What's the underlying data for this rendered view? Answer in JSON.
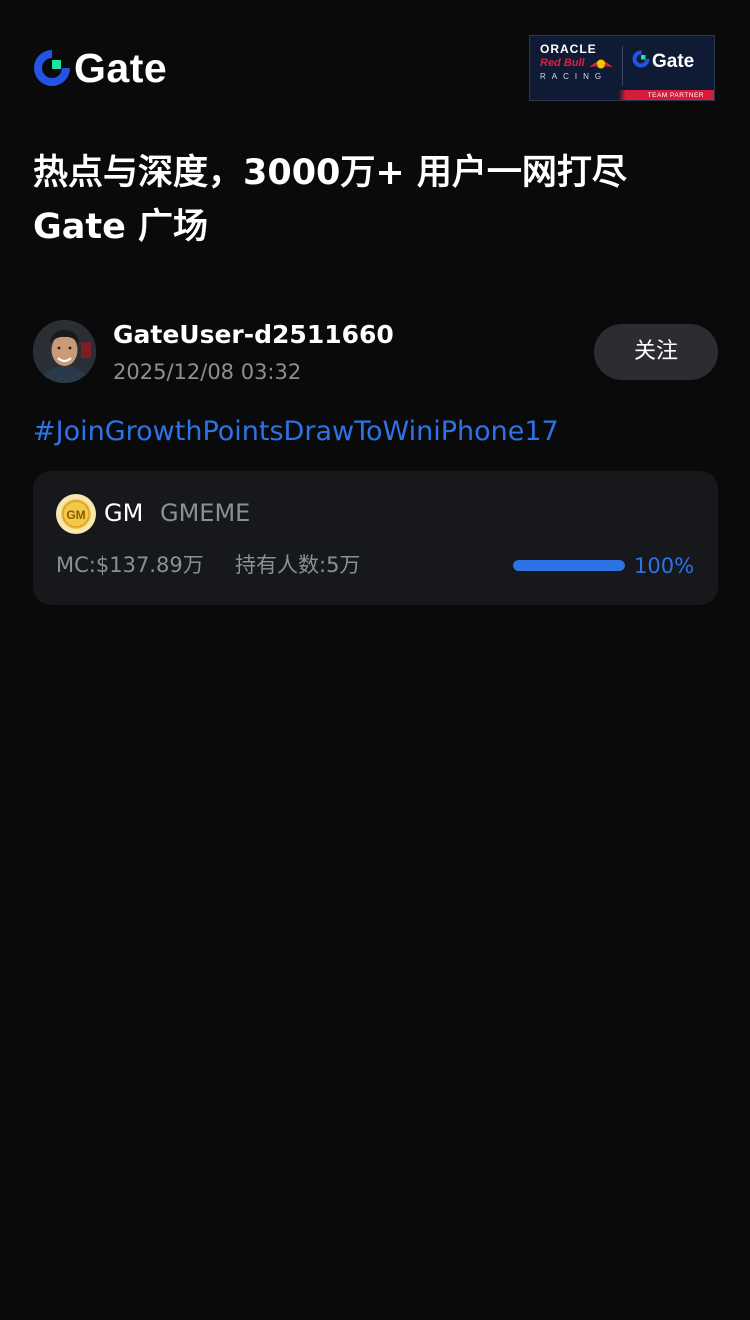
{
  "header": {
    "logo_text": "Gate",
    "partner_badge": {
      "line1": "ORACLE",
      "line2": "Red Bull",
      "line3": "RACING",
      "brand": "Gate",
      "strip": "TEAM PARTNER"
    }
  },
  "headline": {
    "line1": "热点与深度，3000万+ 用户一网打尽",
    "line2": "Gate 广场"
  },
  "post": {
    "author": {
      "name": "GateUser-d2511660",
      "time": "2025/12/08 03:32",
      "follow_label": "关注"
    },
    "hashtag": "#JoinGrowthPointsDrawToWiniPhone17",
    "token": {
      "symbol": "GM",
      "name": "GMEME",
      "icon_text": "GM",
      "market_cap": "MC:$137.89万",
      "holders": "持有人数:5万",
      "progress_percent": 100,
      "progress_label": "100%"
    }
  },
  "colors": {
    "background": "#0a0a0a",
    "card": "#16181b",
    "accent_blue": "#2e73e6",
    "brand_blue": "#2354e6",
    "brand_green": "#17e5a1",
    "muted_text": "#8b8f96",
    "follow_button": "#2b2d31"
  },
  "icons": {
    "logo": "gate-logo-icon",
    "token": "gm-coin-icon",
    "avatar": "user-avatar"
  }
}
